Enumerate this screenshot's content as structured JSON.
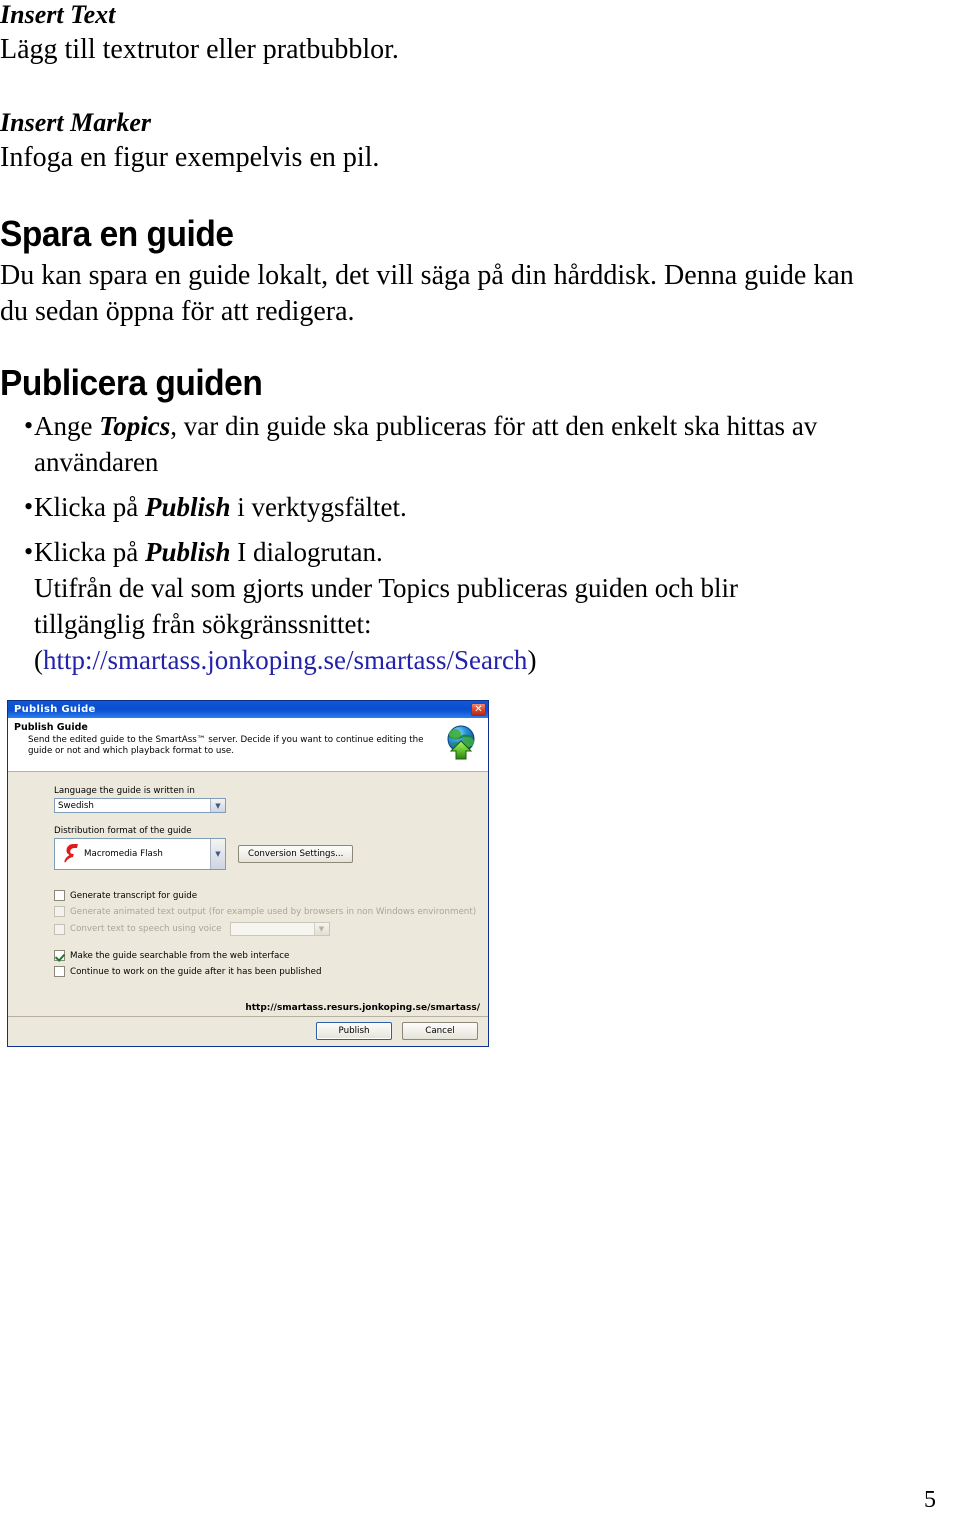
{
  "document": {
    "sections": [
      {
        "heading": "Insert Text",
        "body": "Lägg till textrutor eller pratbubblor."
      },
      {
        "heading": "Insert Marker",
        "body": "Infoga en figur exempelvis en pil."
      }
    ],
    "save_heading": "Spara en guide",
    "save_body_line1": "Du kan spara en guide lokalt, det vill säga på din hårddisk. Denna guide kan",
    "save_body_line2": "du sedan öppna för att redigera.",
    "publish_heading": "Publicera guiden",
    "bullet_marker": "•",
    "bullets": [
      {
        "pre": "Ange ",
        "em": "Topics",
        "post": ", var din guide ska publiceras för att den enkelt ska hittas av användaren"
      },
      {
        "pre": "Klicka på ",
        "em": "Publish",
        "post": " i verktygsfältet."
      },
      {
        "pre": "Klicka på ",
        "em": "Publish",
        "post": " I dialogrutan."
      }
    ],
    "trailing_line1": "Utifrån de val som gjorts under Topics publiceras guiden och blir",
    "trailing_line2": "tillgänglig från sökgränssnittet:",
    "url_open_paren": "(",
    "url_text": "http://smartass.jonkoping.se/smartass/Search",
    "url_close_paren": ")",
    "url_color": "#2222aa",
    "page_number": "5"
  },
  "dialog": {
    "title": "Publish Guide",
    "close_icon_glyph": "✕",
    "banner": {
      "title": "Publish Guide",
      "description": "Send the edited guide to the SmartAss™ server. Decide if you want to continue editing the guide or not and which playback format to use."
    },
    "language": {
      "label": "Language the guide is written in",
      "value": "Swedish",
      "arrow_glyph": "▼"
    },
    "distribution": {
      "label": "Distribution format of the guide",
      "value": "Macromedia Flash",
      "arrow_glyph": "▼",
      "icon_glyph": "f",
      "icon_color": "#e01b1b",
      "settings_button": "Conversion Settings..."
    },
    "checkboxes": [
      {
        "label": "Generate transcript for guide",
        "checked": false,
        "disabled": false
      },
      {
        "label": "Generate animated text output (for example used by browsers in non Windows environment)",
        "checked": false,
        "disabled": true
      },
      {
        "label": "Convert text to speech using voice",
        "checked": false,
        "disabled": true,
        "has_combo": true,
        "combo_value": ""
      },
      {
        "label": "Make the guide searchable from the web interface",
        "checked": true,
        "disabled": false
      },
      {
        "label": "Continue to work on the guide after it has been published",
        "checked": false,
        "disabled": false
      }
    ],
    "server_url": "http://smartass.resurs.jonkoping.se/smartass/",
    "buttons": {
      "publish": "Publish",
      "cancel": "Cancel"
    },
    "colors": {
      "titlebar": "#0a4ecb",
      "body": "#ece9dc",
      "close": "#d8442a"
    }
  }
}
